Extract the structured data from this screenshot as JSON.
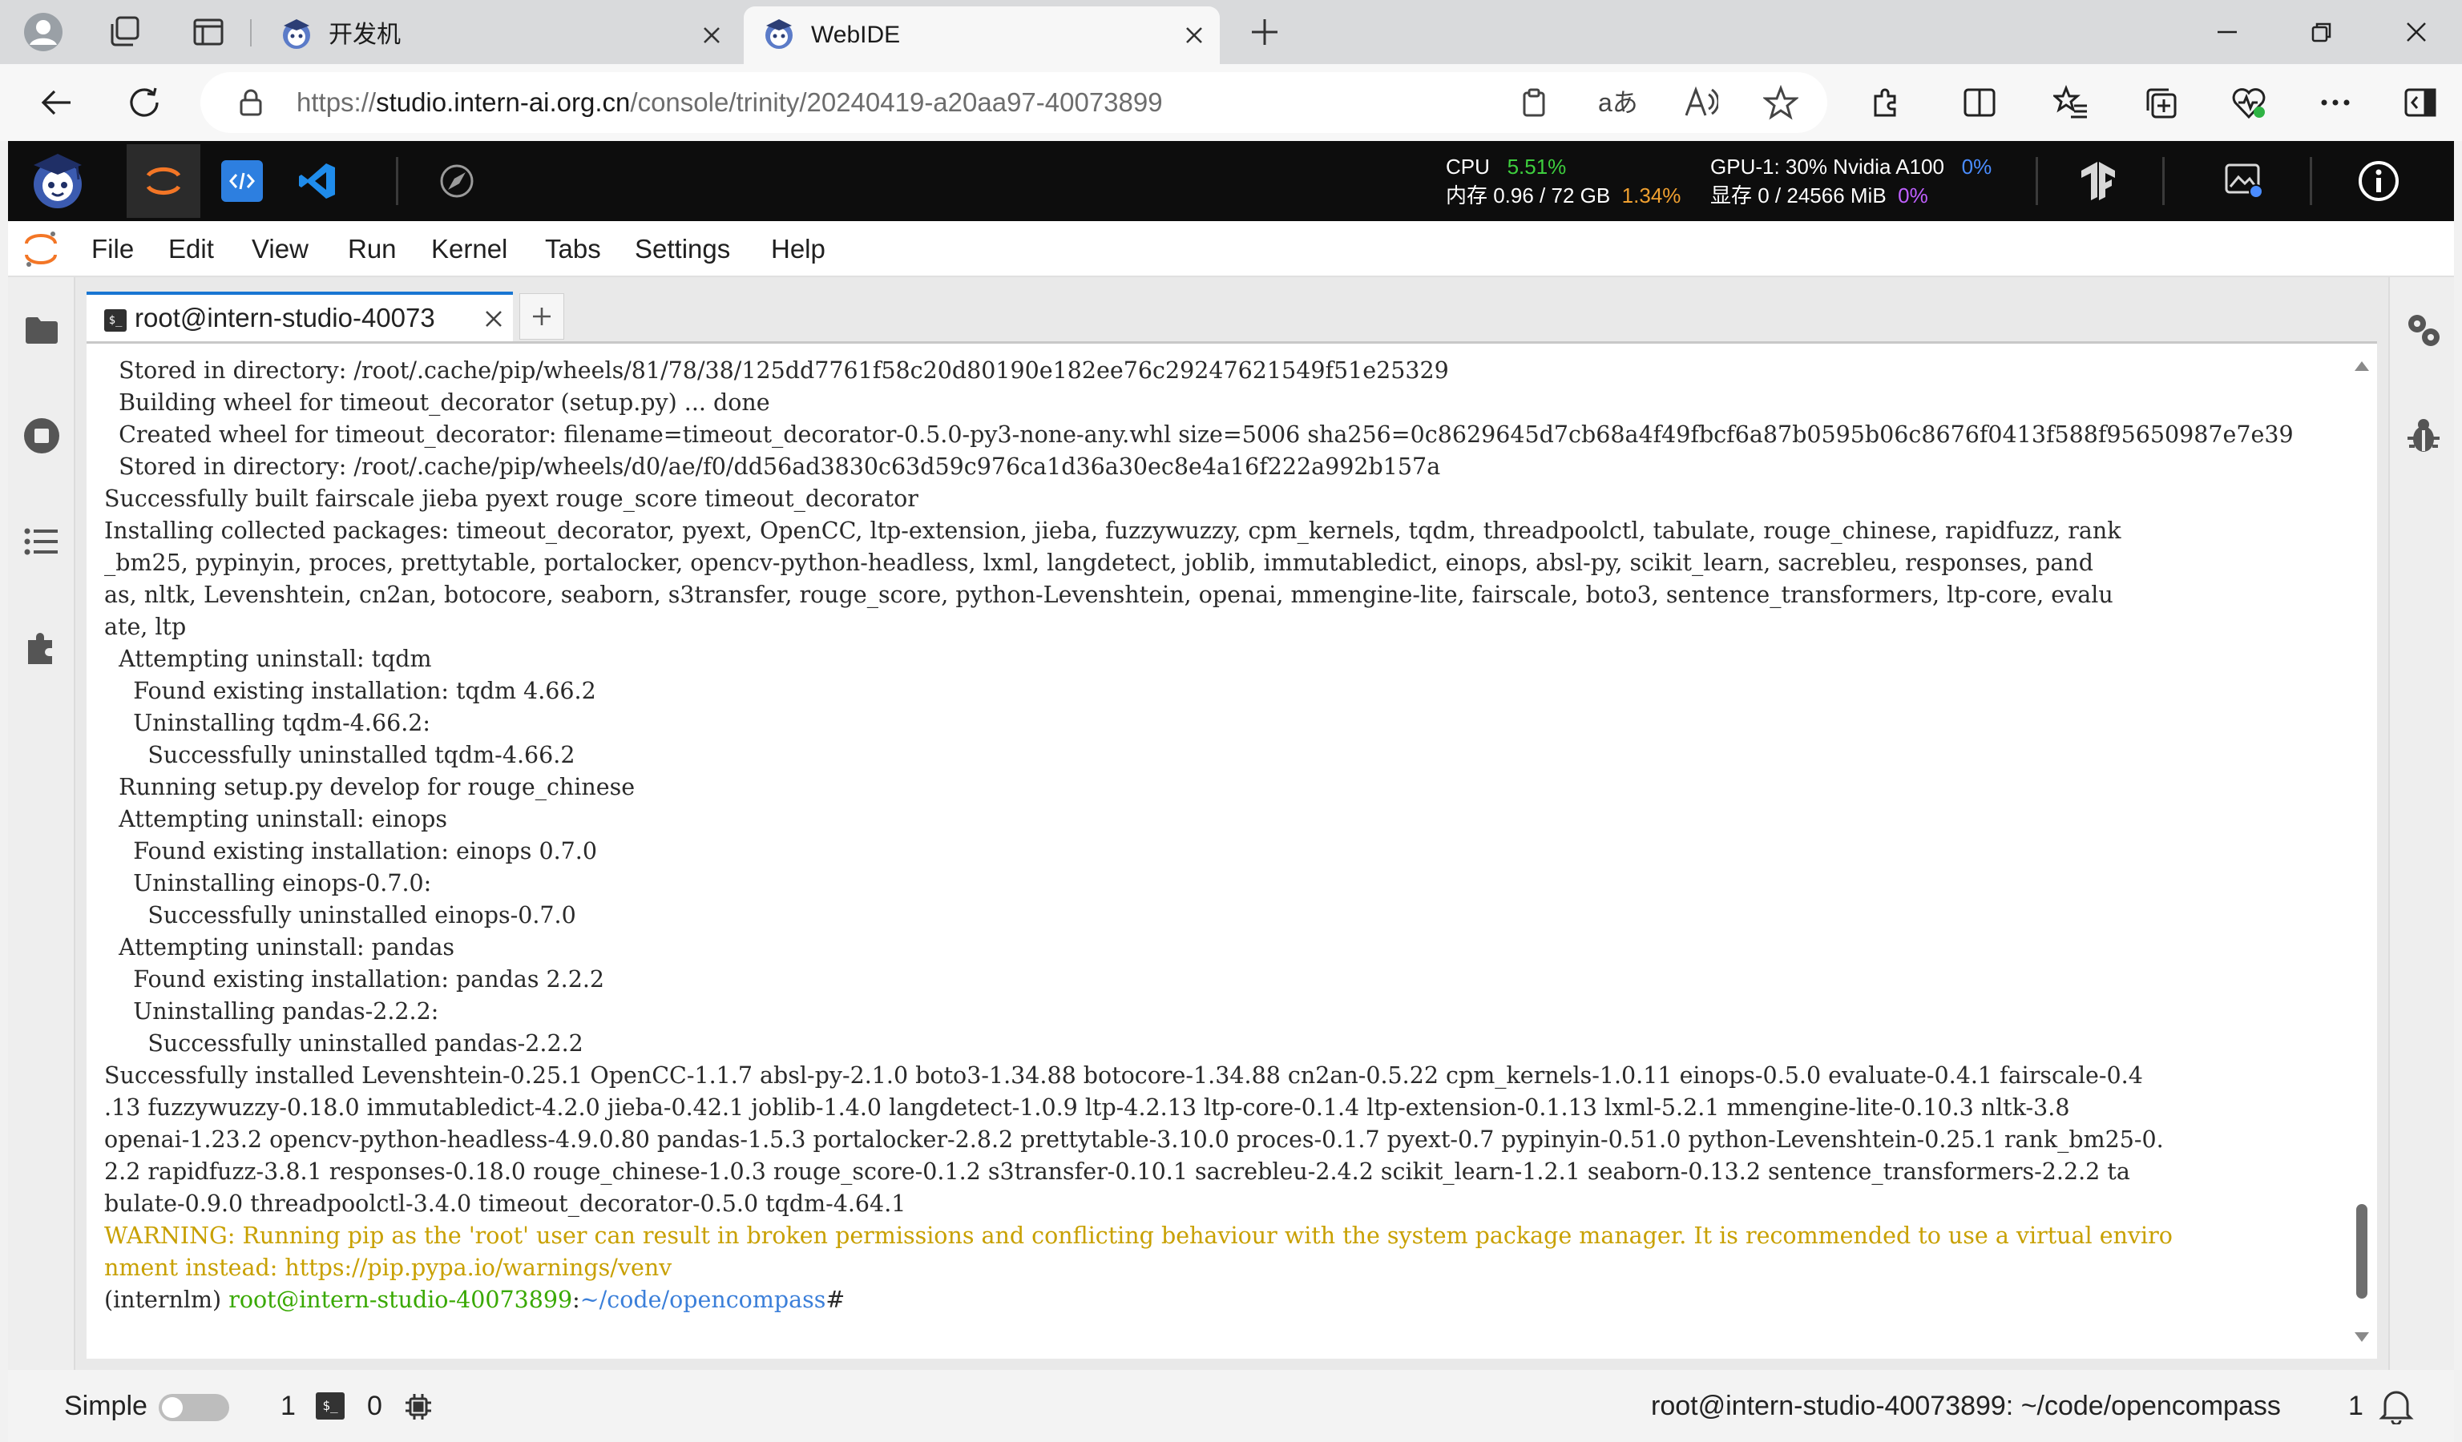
{
  "browser": {
    "tabs": [
      {
        "title": "开发机",
        "active": false
      },
      {
        "title": "WebIDE",
        "active": true
      }
    ],
    "url_scheme": "https://",
    "url_host": "studio.intern-ai.org.cn",
    "url_path": "/console/trinity/20240419-a20aa97-40073899"
  },
  "resources": {
    "cpu_label": "CPU",
    "cpu_value": "5.51%",
    "mem_label": "内存 0.96 / 72 GB",
    "mem_value": "1.34%",
    "gpu_label": "GPU-1: 30% Nvidia A100",
    "gpu_value": "0%",
    "vram_label": "显存 0 / 24566 MiB",
    "vram_value": "0%"
  },
  "menu": [
    "File",
    "Edit",
    "View",
    "Run",
    "Kernel",
    "Tabs",
    "Settings",
    "Help"
  ],
  "terminal": {
    "tab_title": "root@intern-studio-40073",
    "lines": [
      "  Stored in directory: /root/.cache/pip/wheels/81/78/38/125dd7761f58c20d80190e182ee76c29247621549f51e25329",
      "  Building wheel for timeout_decorator (setup.py) ... done",
      "  Created wheel for timeout_decorator: filename=timeout_decorator-0.5.0-py3-none-any.whl size=5006 sha256=0c8629645d7cb68a4f49fbcf6a87b0595b06c8676f0413f588f95650987e7e39",
      "  Stored in directory: /root/.cache/pip/wheels/d0/ae/f0/dd56ad3830c63d59c976ca1d36a30ec8e4a16f222a992b157a",
      "Successfully built fairscale jieba pyext rouge_score timeout_decorator",
      "Installing collected packages: timeout_decorator, pyext, OpenCC, ltp-extension, jieba, fuzzywuzzy, cpm_kernels, tqdm, threadpoolctl, tabulate, rouge_chinese, rapidfuzz, rank",
      "_bm25, pypinyin, proces, prettytable, portalocker, opencv-python-headless, lxml, langdetect, joblib, immutabledict, einops, absl-py, scikit_learn, sacrebleu, responses, pand",
      "as, nltk, Levenshtein, cn2an, botocore, seaborn, s3transfer, rouge_score, python-Levenshtein, openai, mmengine-lite, fairscale, boto3, sentence_transformers, ltp-core, evalu",
      "ate, ltp",
      "  Attempting uninstall: tqdm",
      "    Found existing installation: tqdm 4.66.2",
      "    Uninstalling tqdm-4.66.2:",
      "      Successfully uninstalled tqdm-4.66.2",
      "  Running setup.py develop for rouge_chinese",
      "  Attempting uninstall: einops",
      "    Found existing installation: einops 0.7.0",
      "    Uninstalling einops-0.7.0:",
      "      Successfully uninstalled einops-0.7.0",
      "  Attempting uninstall: pandas",
      "    Found existing installation: pandas 2.2.2",
      "    Uninstalling pandas-2.2.2:",
      "      Successfully uninstalled pandas-2.2.2",
      "Successfully installed Levenshtein-0.25.1 OpenCC-1.1.7 absl-py-2.1.0 boto3-1.34.88 botocore-1.34.88 cn2an-0.5.22 cpm_kernels-1.0.11 einops-0.5.0 evaluate-0.4.1 fairscale-0.4",
      ".13 fuzzywuzzy-0.18.0 immutabledict-4.2.0 jieba-0.42.1 joblib-1.4.0 langdetect-1.0.9 ltp-4.2.13 ltp-core-0.1.4 ltp-extension-0.1.13 lxml-5.2.1 mmengine-lite-0.10.3 nltk-3.8",
      "openai-1.23.2 opencv-python-headless-4.9.0.80 pandas-1.5.3 portalocker-2.8.2 prettytable-3.10.0 proces-0.1.7 pyext-0.7 pypinyin-0.51.0 python-Levenshtein-0.25.1 rank_bm25-0.",
      "2.2 rapidfuzz-3.8.1 responses-0.18.0 rouge_chinese-1.0.3 rouge_score-0.1.2 s3transfer-0.10.1 sacrebleu-2.4.2 scikit_learn-1.2.1 seaborn-0.13.2 sentence_transformers-2.2.2 ta",
      "bulate-0.9.0 threadpoolctl-3.4.0 timeout_decorator-0.5.0 tqdm-4.64.1"
    ],
    "warning_lines": [
      "WARNING: Running pip as the 'root' user can result in broken permissions and conflicting behaviour with the system package manager. It is recommended to use a virtual enviro",
      "nment instead: https://pip.pypa.io/warnings/venv"
    ],
    "prompt_env": "(internlm) ",
    "prompt_user": "root@intern-studio-40073899",
    "prompt_colon": ":",
    "prompt_path": "~/code/opencompass",
    "prompt_hash": "#"
  },
  "statusbar": {
    "mode": "Simple",
    "kernels": "1",
    "terminals": "0",
    "path": "root@intern-studio-40073899: ~/code/opencompass",
    "notifications": "1"
  },
  "colors": {
    "warning": "#c8a000",
    "prompt_user": "#38a800",
    "prompt_path": "#3b7fd9",
    "cpu": "#3ecf3e",
    "mem": "#f0a030",
    "gpu": "#4a8cff",
    "vram": "#c060ff",
    "accent": "#1976d2"
  }
}
